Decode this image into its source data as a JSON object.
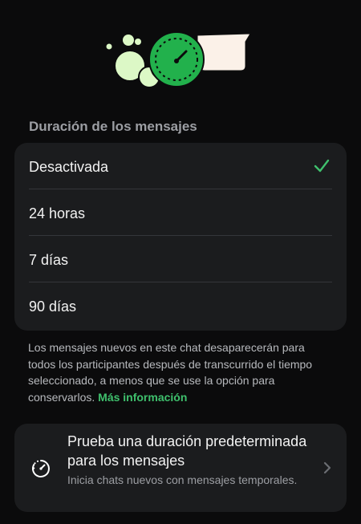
{
  "section_title": "Duración de los mensajes",
  "options": [
    {
      "label": "Desactivada",
      "selected": true
    },
    {
      "label": "24 horas",
      "selected": false
    },
    {
      "label": "7 días",
      "selected": false
    },
    {
      "label": "90 días",
      "selected": false
    }
  ],
  "description": {
    "text": "Los mensajes nuevos en este chat desaparecerán para todos los participantes después de transcurrido el tiempo seleccionado, a menos que se use la opción para conservarlos.",
    "link_label": "Más información"
  },
  "promo": {
    "title": "Prueba una duración predeterminada para los mensajes",
    "subtitle": "Inicia chats nuevos con mensajes temporales."
  },
  "colors": {
    "accent": "#3fc06d",
    "card_background": "#1b1c1e",
    "background": "#0b0b0c",
    "illustration_green": "#22b14c",
    "illustration_light": "#dcf8c6"
  },
  "icons": {
    "selected_check": "check-icon",
    "promo": "timer-icon",
    "promo_arrow": "chevron-right-icon",
    "header": "disappearing-messages-illustration"
  }
}
